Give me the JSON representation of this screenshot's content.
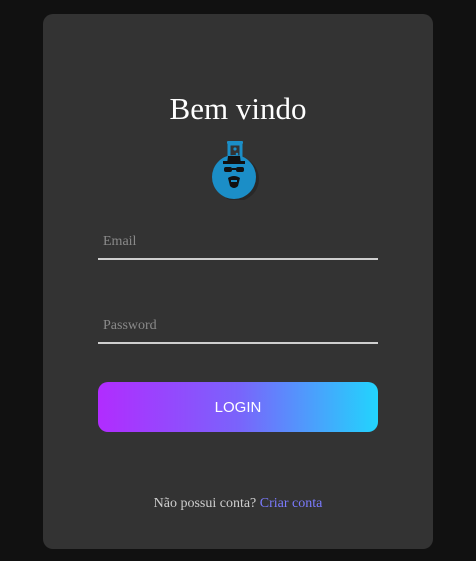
{
  "login": {
    "title": "Bem vindo",
    "logo_icon": "heisenberg-flask-icon",
    "email_placeholder": "Email",
    "email_value": "",
    "password_placeholder": "Password",
    "password_value": "",
    "login_label": "LOGIN",
    "footer_text": "Não possui conta?",
    "create_account_label": "Criar conta"
  },
  "colors": {
    "page_background": "#111111",
    "card_background": "#333333",
    "button_gradient_start": "#b12cff",
    "button_gradient_end": "#22d4fd",
    "link": "#7b7bff",
    "logo_blue": "#1b8ec7"
  }
}
